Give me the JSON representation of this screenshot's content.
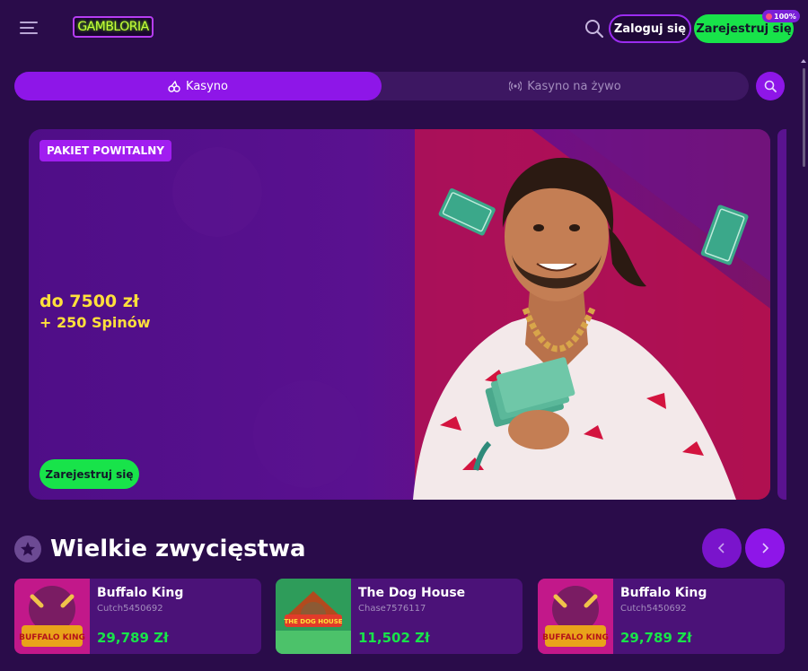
{
  "header": {
    "logo_text": "GAMBLORIA",
    "login_label": "Zaloguj się",
    "register_label": "Zarejestruj się",
    "badge_text": "100%"
  },
  "tabs": {
    "casino": "Kasyno",
    "live_casino": "Kasyno na żywo"
  },
  "banner": {
    "tag": "PAKIET POWITALNY",
    "amount": "do 7500 zł",
    "spins": "+ 250 Spinów",
    "cta": "Zarejestruj się"
  },
  "wins": {
    "title": "Wielkie zwycięstwa",
    "items": [
      {
        "game": "Buffalo King",
        "user": "Cutch5450692",
        "amount": "29,789 Zł",
        "thumb_label": "BUFFALO KING"
      },
      {
        "game": "The Dog House",
        "user": "Chase7576117",
        "amount": "11,502 Zł",
        "thumb_label": "THE DOG HOUSE"
      },
      {
        "game": "Buffalo King",
        "user": "Cutch5450692",
        "amount": "29,789 Zł",
        "thumb_label": "BUFFALO KING"
      }
    ]
  },
  "colors": {
    "background": "#2a0c4a",
    "accent_purple": "#8e16e8",
    "accent_green": "#18e34a",
    "promo_yellow": "#ffe03b"
  },
  "icons": [
    "menu-icon",
    "search-icon",
    "cherry-icon",
    "live-broadcast-icon",
    "star-icon",
    "chevron-left-icon",
    "chevron-right-icon"
  ]
}
